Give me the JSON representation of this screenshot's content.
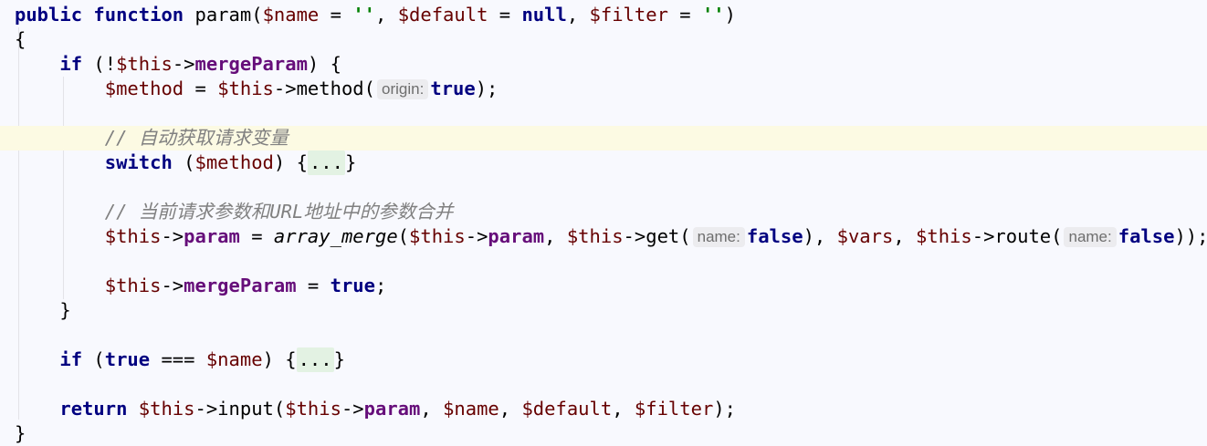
{
  "code": {
    "l1": {
      "public": "public",
      "function": "function",
      "fname": " param(",
      "p1": "$name",
      "eq1": " = ",
      "s1": "''",
      "c1": ", ",
      "p2": "$default",
      "eq2": " = ",
      "null": "null",
      "c2": ", ",
      "p3": "$filter",
      "eq3": " = ",
      "s3": "''",
      "close": ")"
    },
    "l2": {
      "brace": "{"
    },
    "l3": {
      "if": "if",
      "open": " (!",
      "this": "$this",
      "arrow": "->",
      "field": "mergeParam",
      "close": ") {"
    },
    "l4": {
      "var": "$method",
      "eq": " = ",
      "this": "$this",
      "call": "->method(",
      "hint": "origin:",
      "val": "true",
      "end": ");"
    },
    "l6": {
      "comment": "// 自动获取请求变量"
    },
    "l7": {
      "switch": "switch",
      "open": " (",
      "var": "$method",
      "mid": ") {",
      "fold": "...",
      "end": "}"
    },
    "l9": {
      "comment": "// 当前请求参数和URL地址中的参数合并"
    },
    "l10": {
      "this1": "$this",
      "arrow1": "->",
      "field1": "param",
      "eq": " = ",
      "fn": "array_merge",
      "open": "(",
      "this2": "$this",
      "arrow2": "->",
      "field2": "param",
      "c1": ", ",
      "this3": "$this",
      "get": "->get(",
      "hint1": "name:",
      "f1": "false",
      "c2": "), ",
      "vars": "$vars",
      "c3": ", ",
      "this4": "$this",
      "route": "->route(",
      "hint2": "name:",
      "f2": "false",
      "end": "));"
    },
    "l12": {
      "this": "$this",
      "arrow": "->",
      "field": "mergeParam",
      "eq": " = ",
      "val": "true",
      "end": ";"
    },
    "l13": {
      "brace": "}"
    },
    "l15": {
      "if": "if",
      "open": " (",
      "true": "true",
      "op": " === ",
      "var": "$name",
      "mid": ") {",
      "fold": "...",
      "end": "}"
    },
    "l17": {
      "return": "return",
      "sp": " ",
      "this1": "$this",
      "call": "->input(",
      "this2": "$this",
      "arrow": "->",
      "field": "param",
      "c1": ", ",
      "p1": "$name",
      "c2": ", ",
      "p2": "$default",
      "c3": ", ",
      "p3": "$filter",
      "end": ");"
    },
    "l18": {
      "brace": "}"
    }
  }
}
